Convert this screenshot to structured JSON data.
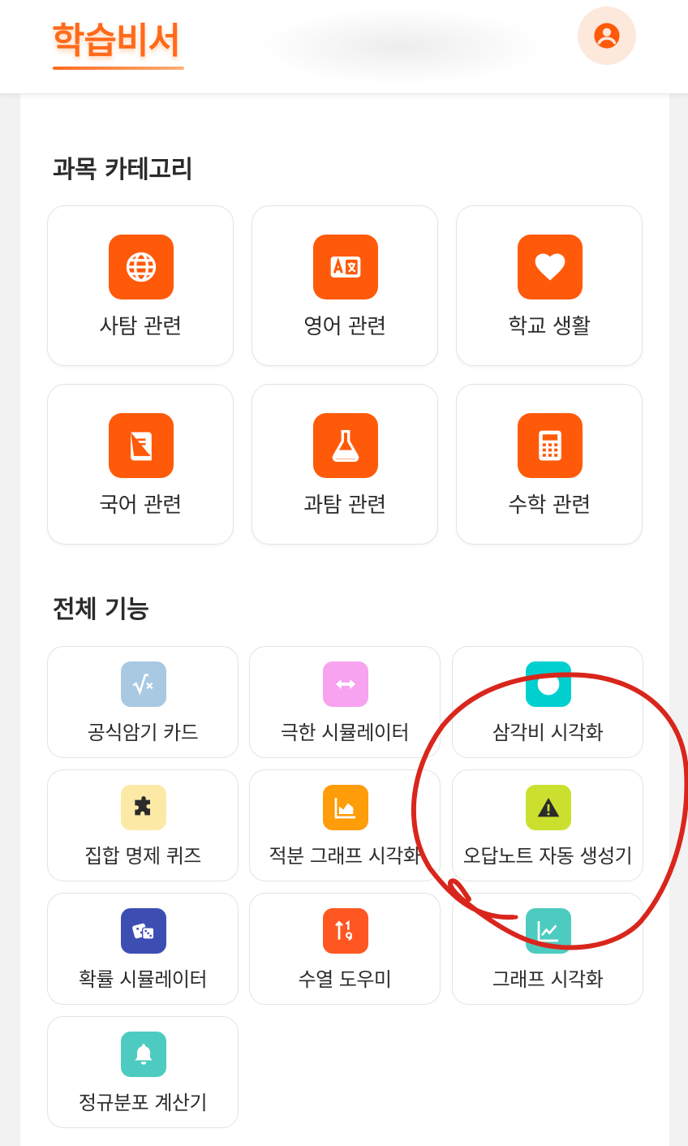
{
  "app": {
    "title": "학습비서",
    "accent": "#ff6a1a"
  },
  "header": {
    "profile_icon": "user-circle-icon"
  },
  "sections": {
    "categories_title": "과목 카테고리",
    "features_title": "전체 기능"
  },
  "categories": [
    {
      "label": "사탐 관련",
      "icon": "globe-icon",
      "color": "#ff5a0a"
    },
    {
      "label": "영어 관련",
      "icon": "language-icon",
      "color": "#ff5a0a"
    },
    {
      "label": "학교 생활",
      "icon": "heart-icon",
      "color": "#ff5a0a"
    },
    {
      "label": "국어 관련",
      "icon": "book-icon",
      "color": "#ff5a0a"
    },
    {
      "label": "과탐 관련",
      "icon": "flask-icon",
      "color": "#ff5a0a"
    },
    {
      "label": "수학 관련",
      "icon": "calculator-icon",
      "color": "#ff5a0a"
    }
  ],
  "features": [
    {
      "label": "공식암기 카드",
      "icon": "square-root-icon",
      "color": "#a9c8e2"
    },
    {
      "label": "극한 시뮬레이터",
      "icon": "arrows-horizontal-icon",
      "color": "#f7a3f0"
    },
    {
      "label": "삼각비 시각화",
      "icon": "circle-icon",
      "color": "#00cfd0"
    },
    {
      "label": "집합 명제 퀴즈",
      "icon": "puzzle-icon",
      "color": "#fde9a6"
    },
    {
      "label": "적분 그래프 시각화",
      "icon": "area-chart-icon",
      "color": "#ff9c0a"
    },
    {
      "label": "오답노트 자동 생성기",
      "icon": "warning-icon",
      "color": "#cbe02e"
    },
    {
      "label": "확률 시뮬레이터",
      "icon": "dice-icon",
      "color": "#3d4eb3"
    },
    {
      "label": "수열 도우미",
      "icon": "sort-numeric-icon",
      "color": "#ff5722"
    },
    {
      "label": "그래프 시각화",
      "icon": "line-chart-icon",
      "color": "#4ecbc0"
    },
    {
      "label": "정규분포 계산기",
      "icon": "bell-icon",
      "color": "#4ecbc0"
    }
  ]
}
